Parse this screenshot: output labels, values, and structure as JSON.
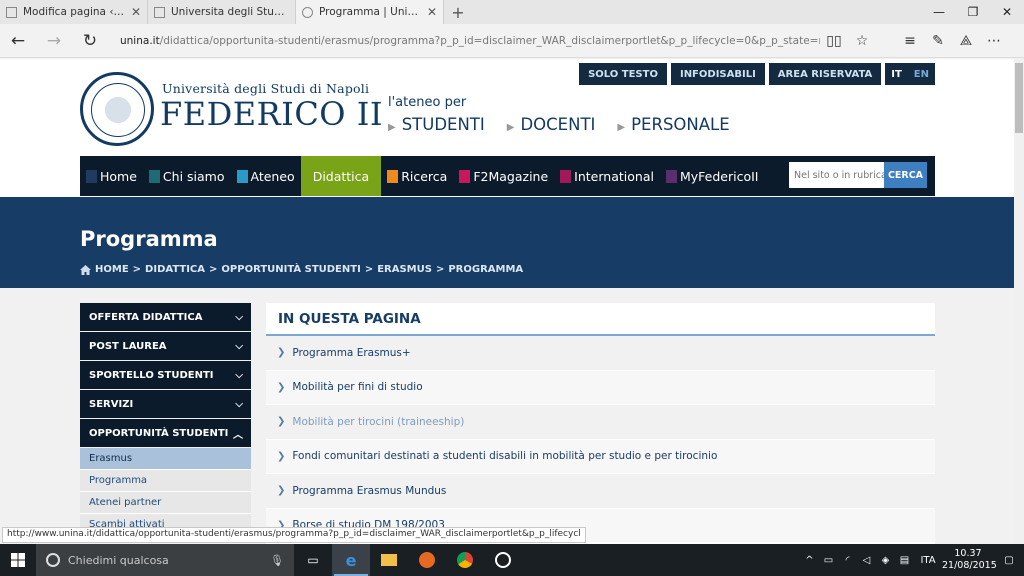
{
  "browser": {
    "tabs": [
      {
        "label": "Modifica pagina ‹ Dietistica -",
        "active": false
      },
      {
        "label": "Universita degli Studi FEDERI",
        "active": false
      },
      {
        "label": "Programma | Università",
        "active": true
      }
    ],
    "url_host": "unina.it",
    "url_rest": "/didattica/opportunita-studenti/erasmus/programma?p_p_id=disclaimer_WAR_disclaimerportlet&p_p_lifecycle=0&p_p_state=normal&p_p_mode=view&"
  },
  "site": {
    "toplinks": [
      "SOLO TESTO",
      "INFODISABILI",
      "AREA RISERVATA"
    ],
    "lang_active": "IT",
    "lang_other": "EN",
    "uni_small": "Università degli Studi di Napoli",
    "uni_big": "FEDERICO II",
    "ateneo_label": "l'ateneo per",
    "audiences": [
      "STUDENTI",
      "DOCENTI",
      "PERSONALE"
    ],
    "nav": [
      {
        "label": "Home",
        "color": "#1f3b5e"
      },
      {
        "label": "Chi siamo",
        "color": "#1e6a75"
      },
      {
        "label": "Ateneo",
        "color": "#2a9bc7"
      },
      {
        "label": "Didattica",
        "color": "#7aa418"
      },
      {
        "label": "Ricerca",
        "color": "#f08a1c"
      },
      {
        "label": "F2Magazine",
        "color": "#c8175d"
      },
      {
        "label": "International",
        "color": "#a01a5a"
      },
      {
        "label": "MyFedericoII",
        "color": "#5b2f6e"
      }
    ],
    "search_placeholder": "Nel sito o in rubrica",
    "search_button": "CERCA"
  },
  "banner": {
    "title": "Programma",
    "breadcrumb": [
      "HOME",
      "DIDATTICA",
      "OPPORTUNITÀ STUDENTI",
      "ERASMUS",
      "PROGRAMMA"
    ]
  },
  "sidebar": {
    "sections": [
      "OFFERTA DIDATTICA",
      "POST LAUREA",
      "SPORTELLO STUDENTI",
      "SERVIZI",
      "OPPORTUNITÀ STUDENTI"
    ],
    "subitems": [
      "Erasmus",
      "Programma",
      "Atenei partner",
      "Scambi attivati"
    ]
  },
  "content": {
    "heading": "IN QUESTA PAGINA",
    "links": [
      "Programma Erasmus+",
      "Mobilità per fini di studio",
      "Mobilità per tirocini (traineeship)",
      "Fondi comunitari destinati a studenti disabili in mobilità per studio e per tirocinio",
      "Programma Erasmus Mundus",
      "Borse di studio DM 198/2003"
    ]
  },
  "status_url": "http://www.unina.it/didattica/opportunita-studenti/erasmus/programma?p_p_id=disclaimer_WAR_disclaimerportlet&p_p_lifecycl",
  "taskbar": {
    "search_placeholder": "Chiedimi qualcosa",
    "lang": "ITA",
    "time": "10.37",
    "date": "21/08/2015"
  }
}
